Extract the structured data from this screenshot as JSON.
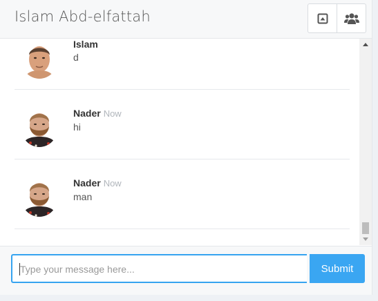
{
  "header": {
    "title": "Islam Abd-elfattah",
    "buttons": [
      {
        "icon": "caret-square-up-icon"
      },
      {
        "icon": "users-icon"
      }
    ]
  },
  "messages": [
    {
      "name": "Islam",
      "time": "",
      "text": "d",
      "avatar": "islam-avatar"
    },
    {
      "name": "Nader",
      "time": "Now",
      "text": "hi",
      "avatar": "nader-avatar"
    },
    {
      "name": "Nader",
      "time": "Now",
      "text": "man",
      "avatar": "nader-avatar"
    }
  ],
  "composer": {
    "placeholder": "Type your message here...",
    "submit_label": "Submit"
  },
  "colors": {
    "accent": "#3aa6f2",
    "header_bg": "#f7f8f9",
    "divider": "#e6e8eb"
  }
}
